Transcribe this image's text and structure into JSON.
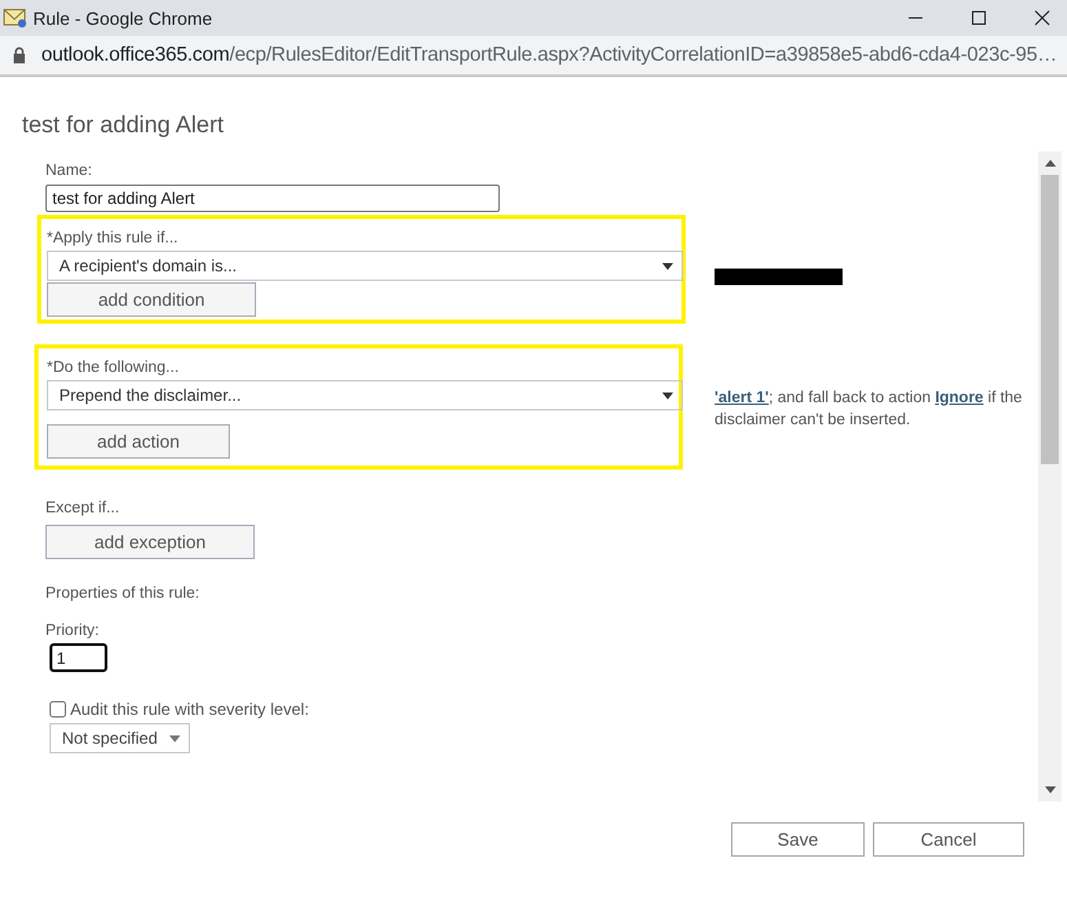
{
  "window": {
    "title": "Rule - Google Chrome"
  },
  "address_bar": {
    "domain": "outlook.office365.com",
    "path": "/ecp/RulesEditor/EditTransportRule.aspx?ActivityCorrelationID=a39858e5-abd6-cda4-023c-95…"
  },
  "page_title": "test for adding Alert",
  "form": {
    "name": {
      "label": "Name:",
      "value": "test for adding Alert"
    },
    "condition": {
      "label": "*Apply this rule if...",
      "value": "A recipient's domain is...",
      "button": "add condition",
      "highlighted": true,
      "detail_redacted": true
    },
    "action": {
      "label": "*Do the following...",
      "value": "Prepend the disclaimer...",
      "button": "add action",
      "highlighted": true,
      "description": [
        {
          "kind": "link",
          "text": "'alert 1'"
        },
        {
          "kind": "text",
          "text": "; and fall back to action "
        },
        {
          "kind": "link",
          "text": "Ignore"
        },
        {
          "kind": "text",
          "text": " if the disclaimer can't be inserted."
        }
      ]
    },
    "exception": {
      "label": "Except if...",
      "button": "add exception"
    },
    "properties_label": "Properties of this rule:",
    "priority": {
      "label": "Priority:",
      "value": "1",
      "focused": true
    },
    "audit": {
      "label": "Audit this rule with severity level:",
      "checked": false
    },
    "severity": {
      "value": "Not specified"
    }
  },
  "buttons": [
    {
      "label": "Save"
    },
    {
      "label": "Cancel"
    }
  ]
}
